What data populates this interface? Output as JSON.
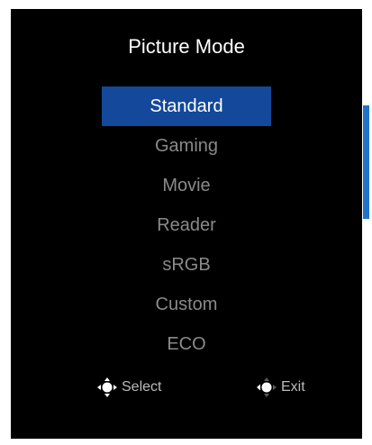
{
  "osd": {
    "title": "Picture Mode",
    "modes": [
      {
        "label": "Standard",
        "selected": true
      },
      {
        "label": "Gaming",
        "selected": false
      },
      {
        "label": "Movie",
        "selected": false
      },
      {
        "label": "Reader",
        "selected": false
      },
      {
        "label": "sRGB",
        "selected": false
      },
      {
        "label": "Custom",
        "selected": false
      },
      {
        "label": "ECO",
        "selected": false
      }
    ],
    "hints": {
      "select_label": "Select",
      "select_icon": "joystick-press-icon",
      "exit_label": "Exit",
      "exit_icon": "joystick-left-icon"
    }
  },
  "colors": {
    "background": "#000000",
    "selected_bg": "#13489a",
    "selected_text": "#ffffff",
    "unselected_text": "#8a8a8a",
    "scroll_indicator": "#1f73c8"
  }
}
